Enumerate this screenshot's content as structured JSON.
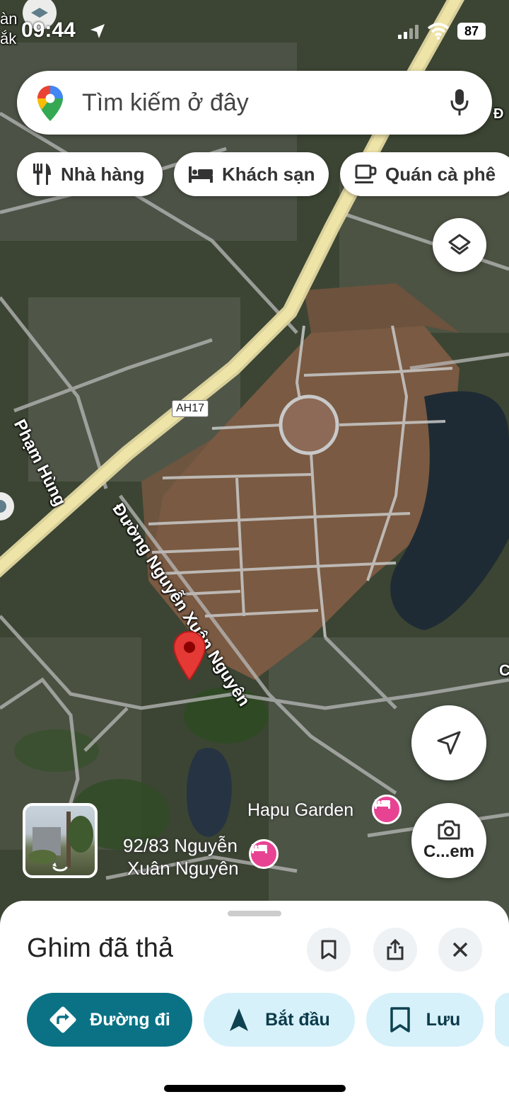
{
  "status_bar": {
    "time": "09:44",
    "battery": "87",
    "corner_text_1": "àn",
    "corner_text_2": "ắk"
  },
  "search": {
    "placeholder": "Tìm kiếm ở đây",
    "logo_icon": "google-maps-pin-icon",
    "mic_icon": "microphone-icon"
  },
  "chips": [
    {
      "label": "Nhà hàng",
      "icon": "fork-knife-icon"
    },
    {
      "label": "Khách sạn",
      "icon": "bed-icon"
    },
    {
      "label": "Quán cà phê",
      "icon": "coffee-cup-icon"
    }
  ],
  "map": {
    "road_shield": "AH17",
    "street_1": "Phạm Hùng",
    "street_2": "Đường Nguyễn Xuân Nguyên",
    "poi_1": "Hapu Garden",
    "poi_2_line1": "92/83 Nguyễn",
    "poi_2_line2": "Xuân Nguyên",
    "edge_letter_1": "Đ",
    "edge_letter_2": "C",
    "pin_color": "#E53935",
    "hotel_marker_color": "#E84393"
  },
  "controls": {
    "layers_icon": "layers-icon",
    "locate_icon": "navigation-arrow-icon",
    "camera_label": "C...em"
  },
  "sheet": {
    "title": "Ghim đã thả",
    "actions": {
      "directions": "Đường đi",
      "start": "Bắt đầu",
      "save": "Lưu"
    },
    "accent": "#0B7285",
    "secondary_bg": "#D7F1FA"
  }
}
